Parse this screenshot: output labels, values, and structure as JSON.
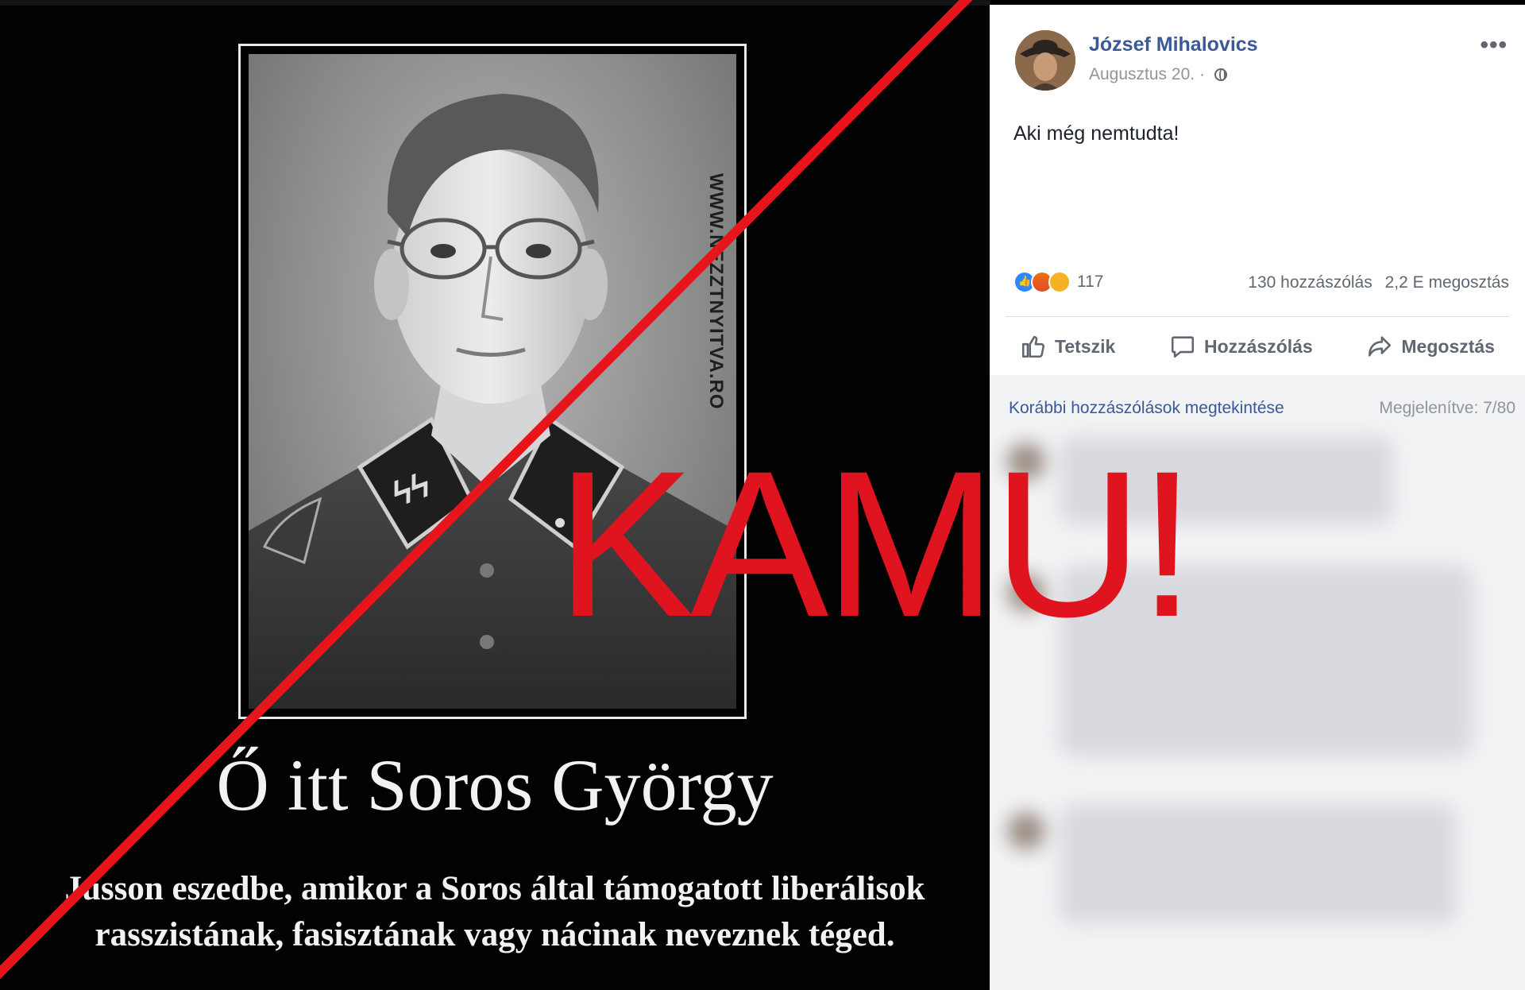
{
  "meme": {
    "watermark": "WWW.NEZZTNYITVA.RO",
    "title": "Ő itt Soros György",
    "caption_line1": "Jusson eszedbe, amikor a Soros által támogatott liberálisok",
    "caption_line2": "rasszistának, fasisztának vagy nácinak neveznek téged."
  },
  "post": {
    "author": "József Mihalovics",
    "date": "Augusztus 20.",
    "privacy_icon": "globe-icon",
    "text": "Aki még nemtudta!",
    "reactions": {
      "icons": [
        "like-reaction-icon",
        "angry-reaction-icon",
        "haha-reaction-icon"
      ],
      "count": "117"
    },
    "comments_count": "130 hozzászólás",
    "shares_count": "2,2 E megosztás",
    "actions": {
      "like": "Tetszik",
      "comment": "Hozzászólás",
      "share": "Megosztás"
    },
    "previous_comments_link": "Korábbi hozzászólások megtekintése",
    "shown_count": "Megjelenítve: 7/80"
  },
  "overlay": {
    "stamp": "KAMU!",
    "stamp_color": "#e0141f"
  },
  "colors": {
    "facebook_link": "#3b5998",
    "meta_gray": "#90949c",
    "strike_red": "#e8141c"
  }
}
